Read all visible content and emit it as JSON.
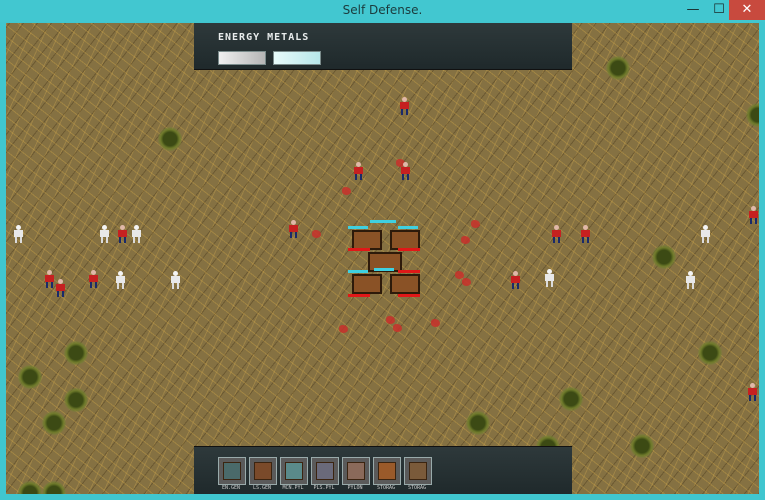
{
  "window": {
    "title": "Self Defense.",
    "minimize_glyph": "—",
    "maximize_glyph": "☐",
    "close_glyph": "✕"
  },
  "hud": {
    "resources_label": "ENERGY METALS"
  },
  "build_menu": {
    "items": [
      {
        "label": "EN.GEN",
        "icon": "energy-generator-icon"
      },
      {
        "label": "LS.GEN",
        "icon": "metal-generator-icon"
      },
      {
        "label": "MCN.PYL",
        "icon": "machine-pylon-icon"
      },
      {
        "label": "PLS.PYL",
        "icon": "plasma-pylon-icon"
      },
      {
        "label": "PYLON",
        "icon": "pylon-icon"
      },
      {
        "label": "STORAG",
        "icon": "storage-icon"
      },
      {
        "label": "STORAG",
        "icon": "storage-alt-icon"
      }
    ]
  },
  "colors": {
    "window_frame": "#40c6cf",
    "ground": "#857142",
    "hud_bg": "#2e393b",
    "enemy_red": "#c62020",
    "enemy_white": "#e8e8e8",
    "shield": "#3fd0e0"
  }
}
